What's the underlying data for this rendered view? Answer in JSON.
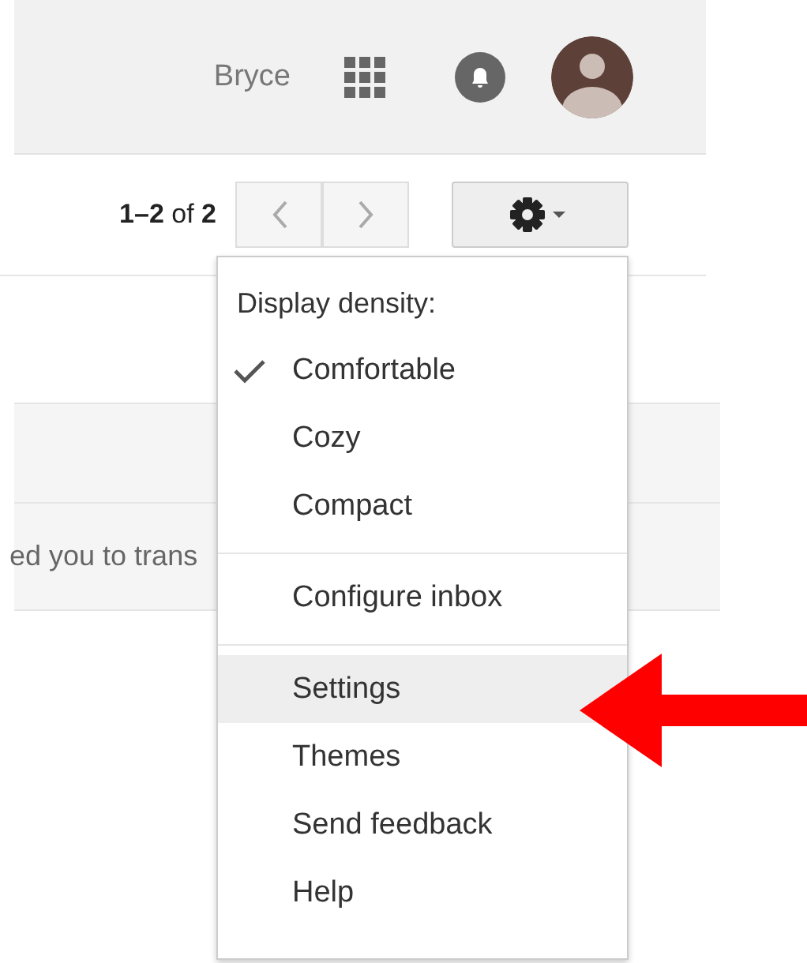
{
  "header": {
    "user_name": "Bryce"
  },
  "toolbar": {
    "pager": "**1–2** of **2**"
  },
  "message_rows": [
    {
      "kind": "blank"
    },
    {
      "kind": "snippet",
      "text": "ed you to trans"
    }
  ],
  "menu": {
    "heading": "Display density:",
    "groups": [
      {
        "items": [
          {
            "label": "Comfortable",
            "checked": true,
            "selected": false
          },
          {
            "label": "Cozy",
            "checked": false,
            "selected": false
          },
          {
            "label": "Compact",
            "checked": false,
            "selected": false
          }
        ]
      },
      {
        "items": [
          {
            "label": "Configure inbox",
            "checked": false,
            "selected": false
          }
        ]
      },
      {
        "items": [
          {
            "label": "Settings",
            "checked": false,
            "selected": true
          },
          {
            "label": "Themes",
            "checked": false,
            "selected": false
          },
          {
            "label": "Send feedback",
            "checked": false,
            "selected": false
          },
          {
            "label": "Help",
            "checked": false,
            "selected": false
          }
        ]
      }
    ]
  }
}
